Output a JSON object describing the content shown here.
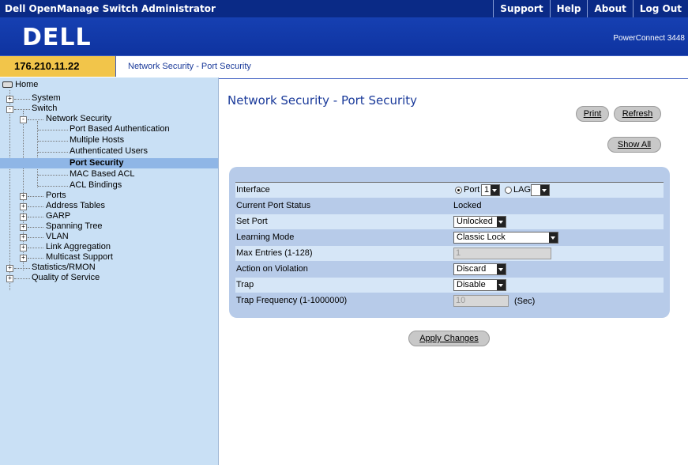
{
  "app": {
    "title": "Dell OpenManage Switch Administrator",
    "nav": [
      "Support",
      "Help",
      "About",
      "Log Out"
    ],
    "logo_text": "DELL",
    "model": "PowerConnect 3448",
    "ip": "176.210.11.22",
    "breadcrumb": "Network Security - Port Security"
  },
  "colors": {
    "topbar": "#0a2a86",
    "brandbar": "#1640b2",
    "ip_bg": "#f2c54a",
    "sidebar_bg": "#c9e0f5",
    "panel_bg": "#b7cbe9",
    "row_alt": "#d6e6f7",
    "title_text": "#1a3a9a"
  },
  "sidebar": {
    "items": [
      {
        "label": "Home",
        "icon": "switch-icon"
      },
      {
        "label": "System",
        "toggle": "+"
      },
      {
        "label": "Switch",
        "toggle": "-"
      },
      {
        "label": "Network Security",
        "toggle": "-"
      },
      {
        "label": "Port Based Authentication"
      },
      {
        "label": "Multiple Hosts"
      },
      {
        "label": "Authenticated Users"
      },
      {
        "label": "Port Security",
        "selected": true
      },
      {
        "label": "MAC Based ACL"
      },
      {
        "label": "ACL Bindings"
      },
      {
        "label": "Ports",
        "toggle": "+"
      },
      {
        "label": "Address Tables",
        "toggle": "+"
      },
      {
        "label": "GARP",
        "toggle": "+"
      },
      {
        "label": "Spanning Tree",
        "toggle": "+"
      },
      {
        "label": "VLAN",
        "toggle": "+"
      },
      {
        "label": "Link Aggregation",
        "toggle": "+"
      },
      {
        "label": "Multicast Support",
        "toggle": "+"
      },
      {
        "label": "Statistics/RMON",
        "toggle": "+"
      },
      {
        "label": "Quality of Service",
        "toggle": "+"
      }
    ]
  },
  "main": {
    "title": "Network Security - Port Security",
    "buttons": {
      "print": "Print",
      "refresh": "Refresh",
      "show_all": "Show All",
      "apply": "Apply Changes"
    },
    "form": {
      "interface": {
        "label": "Interface",
        "port_label": "Port",
        "port_value": "1",
        "lag_label": "LAG",
        "lag_value": "",
        "selected": "Port"
      },
      "current_port_status": {
        "label": "Current Port Status",
        "value": "Locked"
      },
      "set_port": {
        "label": "Set Port",
        "value": "Unlocked"
      },
      "learning_mode": {
        "label": "Learning Mode",
        "value": "Classic Lock"
      },
      "max_entries": {
        "label": "Max Entries (1-128)",
        "value": "1"
      },
      "action_on_violation": {
        "label": "Action on Violation",
        "value": "Discard"
      },
      "trap": {
        "label": "Trap",
        "value": "Disable"
      },
      "trap_frequency": {
        "label": "Trap Frequency (1-1000000)",
        "value": "10",
        "unit": "(Sec)"
      }
    }
  }
}
